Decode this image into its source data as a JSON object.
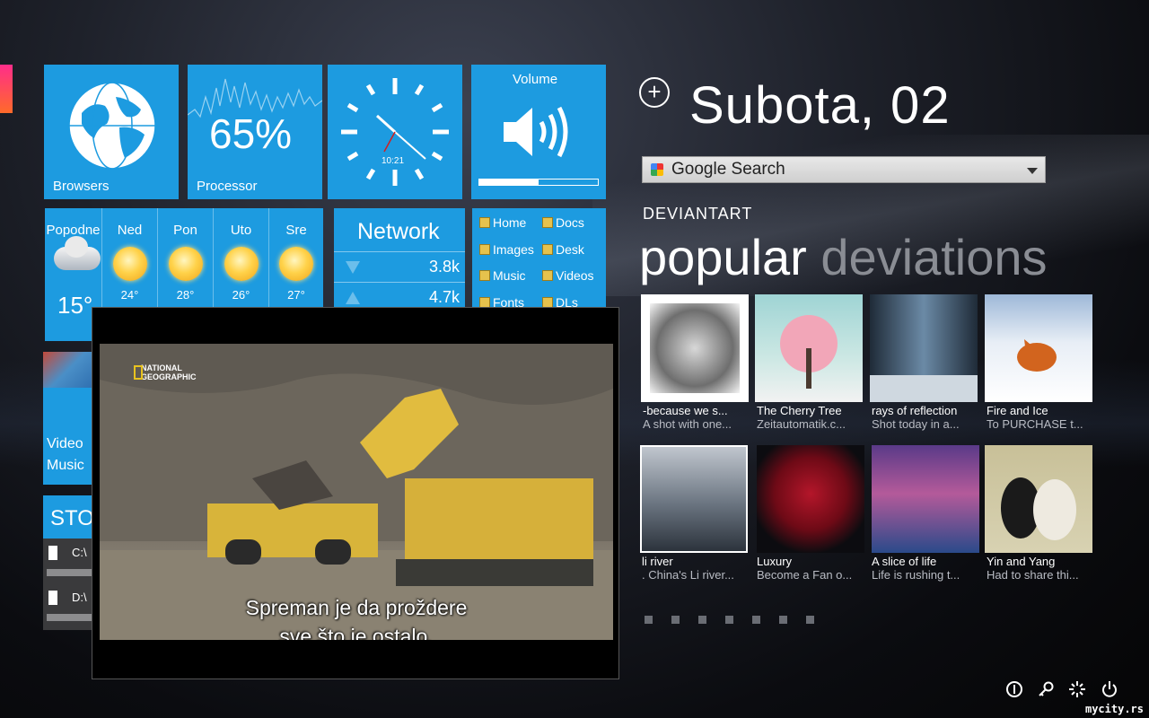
{
  "tiles": {
    "browsers_label": "Browsers",
    "processor_value": "65%",
    "processor_label": "Processor",
    "clock_time": "10:21",
    "volume_label": "Volume"
  },
  "weather": {
    "days": [
      {
        "day": "Popodne",
        "temp": "15°",
        "icon": "cloud-icon"
      },
      {
        "day": "Ned",
        "temp": "24°",
        "icon": "sun-icon"
      },
      {
        "day": "Pon",
        "temp": "28°",
        "icon": "sun-icon"
      },
      {
        "day": "Uto",
        "temp": "26°",
        "icon": "sun-icon"
      },
      {
        "day": "Sre",
        "temp": "27°",
        "icon": "sun-icon"
      }
    ]
  },
  "network": {
    "title": "Network",
    "down": "3.8k",
    "up": "4.7k"
  },
  "links": {
    "items": [
      "Home",
      "Docs",
      "Images",
      "Desk",
      "Music",
      "Videos",
      "Fonts",
      "DLs"
    ]
  },
  "media": {
    "video_label": "Video",
    "music_label": "Music"
  },
  "storage": {
    "title": "STO",
    "drive_c": "C:\\",
    "drive_d": "D:\\"
  },
  "video": {
    "channel_line1": "NATIONAL",
    "channel_line2": "GEOGRAPHIC",
    "subtitle_line1": "Spreman je da proždere",
    "subtitle_line2": "sve što je ostalo."
  },
  "header": {
    "date": "Subota, 02",
    "add_icon": "plus-circle-icon"
  },
  "search": {
    "label": "Google Search"
  },
  "deviantart": {
    "section_label": "DEVIANTART",
    "heading_word1": "popular",
    "heading_word2": "deviations",
    "items": [
      {
        "title": "-because we s...",
        "sub": "A shot with one..."
      },
      {
        "title": "The Cherry Tree",
        "sub": "Zeitautomatik.c..."
      },
      {
        "title": "rays of reflection",
        "sub": "Shot today in a..."
      },
      {
        "title": "Fire and Ice",
        "sub": "To PURCHASE t..."
      },
      {
        "title": "li river",
        "sub": ". China's Li river..."
      },
      {
        "title": "Luxury",
        "sub": "Become a Fan o..."
      },
      {
        "title": "A slice of life",
        "sub": "Life is rushing t..."
      },
      {
        "title": "Yin and Yang",
        "sub": "Had to share thi..."
      }
    ],
    "page_count": 7
  },
  "system_icons": [
    "info-icon",
    "key-icon",
    "loading-icon",
    "power-icon"
  ],
  "watermark": "mycity.rs",
  "colors": {
    "tile": "#1d9be0",
    "accent": "#ff2d8a"
  }
}
